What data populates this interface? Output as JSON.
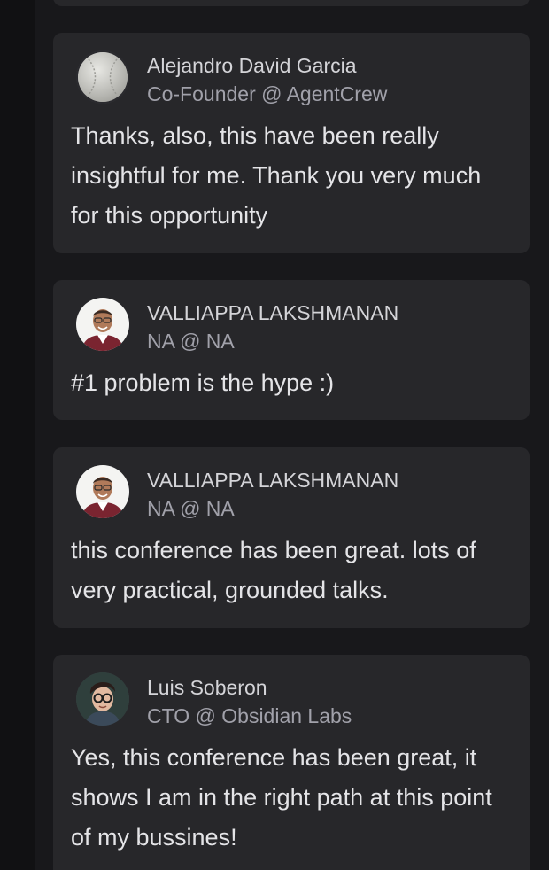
{
  "comments": [
    {
      "name": "Alejandro David Garcia",
      "role": "Co-Founder @ AgentCrew",
      "avatar_icon": "baseball-avatar",
      "message": "Thanks, also, this have been really insightful for me. Thank you very much for this opportunity"
    },
    {
      "name": "VALLIAPPA LAKSHMANAN",
      "role": "NA @ NA",
      "avatar_icon": "person-photo-avatar",
      "message": "#1 problem is the hype :)"
    },
    {
      "name": "VALLIAPPA LAKSHMANAN",
      "role": "NA @ NA",
      "avatar_icon": "person-photo-avatar",
      "message": "this conference has been great. lots of very practical, grounded talks."
    },
    {
      "name": "Luis Soberon",
      "role": "CTO @ Obsidian Labs",
      "avatar_icon": "illustrated-avatar",
      "message": "Yes, this conference has been great, it shows I am in the right path at this point of my bussines!"
    }
  ],
  "colors": {
    "background": "#18181b",
    "card": "#27272a",
    "rail": "#111113",
    "name_text": "#d4d4d8",
    "role_text": "#a1a1aa",
    "message_text": "#e4e4e7"
  }
}
